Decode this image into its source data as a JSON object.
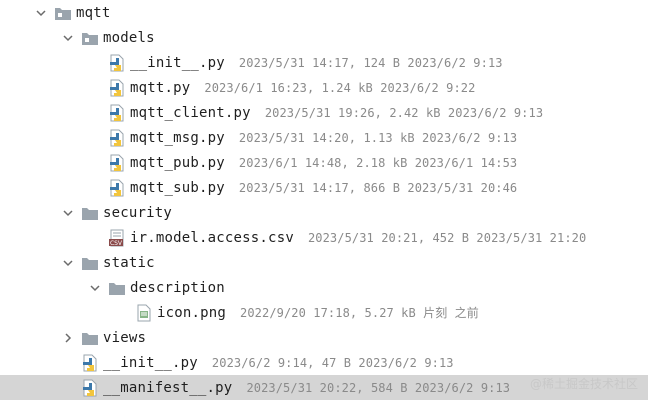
{
  "tree": {
    "rows": [
      {
        "name": "mqtt",
        "meta": "",
        "kind": "folder",
        "depth": 0,
        "expanded": true,
        "icon": "folder-module-icon"
      },
      {
        "name": "models",
        "meta": "",
        "kind": "folder",
        "depth": 1,
        "expanded": true,
        "icon": "folder-module-icon"
      },
      {
        "name": "__init__.py",
        "meta": "2023/5/31 14:17, 124 B 2023/6/2 9:13",
        "kind": "python",
        "depth": 2,
        "icon": "python-file-icon"
      },
      {
        "name": "mqtt.py",
        "meta": "2023/6/1 16:23, 1.24 kB 2023/6/2 9:22",
        "kind": "python",
        "depth": 2,
        "icon": "python-file-icon"
      },
      {
        "name": "mqtt_client.py",
        "meta": "2023/5/31 19:26, 2.42 kB 2023/6/2 9:13",
        "kind": "python",
        "depth": 2,
        "icon": "python-file-icon"
      },
      {
        "name": "mqtt_msg.py",
        "meta": "2023/5/31 14:20, 1.13 kB 2023/6/2 9:13",
        "kind": "python",
        "depth": 2,
        "icon": "python-file-icon"
      },
      {
        "name": "mqtt_pub.py",
        "meta": "2023/6/1 14:48, 2.18 kB 2023/6/1 14:53",
        "kind": "python",
        "depth": 2,
        "icon": "python-file-icon"
      },
      {
        "name": "mqtt_sub.py",
        "meta": "2023/5/31 14:17, 866 B 2023/5/31 20:46",
        "kind": "python",
        "depth": 2,
        "icon": "python-file-icon"
      },
      {
        "name": "security",
        "meta": "",
        "kind": "folder",
        "depth": 1,
        "expanded": true,
        "icon": "folder-icon"
      },
      {
        "name": "ir.model.access.csv",
        "meta": "2023/5/31 20:21, 452 B 2023/5/31 21:20",
        "kind": "csv",
        "depth": 2,
        "icon": "csv-file-icon"
      },
      {
        "name": "static",
        "meta": "",
        "kind": "folder",
        "depth": 1,
        "expanded": true,
        "icon": "folder-icon"
      },
      {
        "name": "description",
        "meta": "",
        "kind": "folder",
        "depth": 2,
        "expanded": true,
        "icon": "folder-icon"
      },
      {
        "name": "icon.png",
        "meta": "2022/9/20 17:18, 5.27 kB 片刻 之前",
        "kind": "image",
        "depth": 3,
        "icon": "image-file-icon"
      },
      {
        "name": "views",
        "meta": "",
        "kind": "folder",
        "depth": 1,
        "expanded": false,
        "icon": "folder-icon"
      },
      {
        "name": "__init__.py",
        "meta": "2023/6/2 9:14, 47 B 2023/6/2 9:13",
        "kind": "python",
        "depth": 1,
        "icon": "python-file-icon"
      },
      {
        "name": "__manifest__.py",
        "meta": "2023/5/31 20:22, 584 B 2023/6/2 9:13",
        "kind": "python",
        "depth": 1,
        "icon": "python-file-icon",
        "selected": true
      }
    ]
  },
  "watermark": "@稀土掘金技术社区",
  "colors": {
    "folder": "#9aa4ad",
    "python_blue": "#3c78aa",
    "python_yellow": "#f2c53d",
    "selection": "#d5d5d5",
    "meta_text": "#8a8a8a",
    "csv_red": "#8a4a4a",
    "image_green": "#6aa36a"
  }
}
